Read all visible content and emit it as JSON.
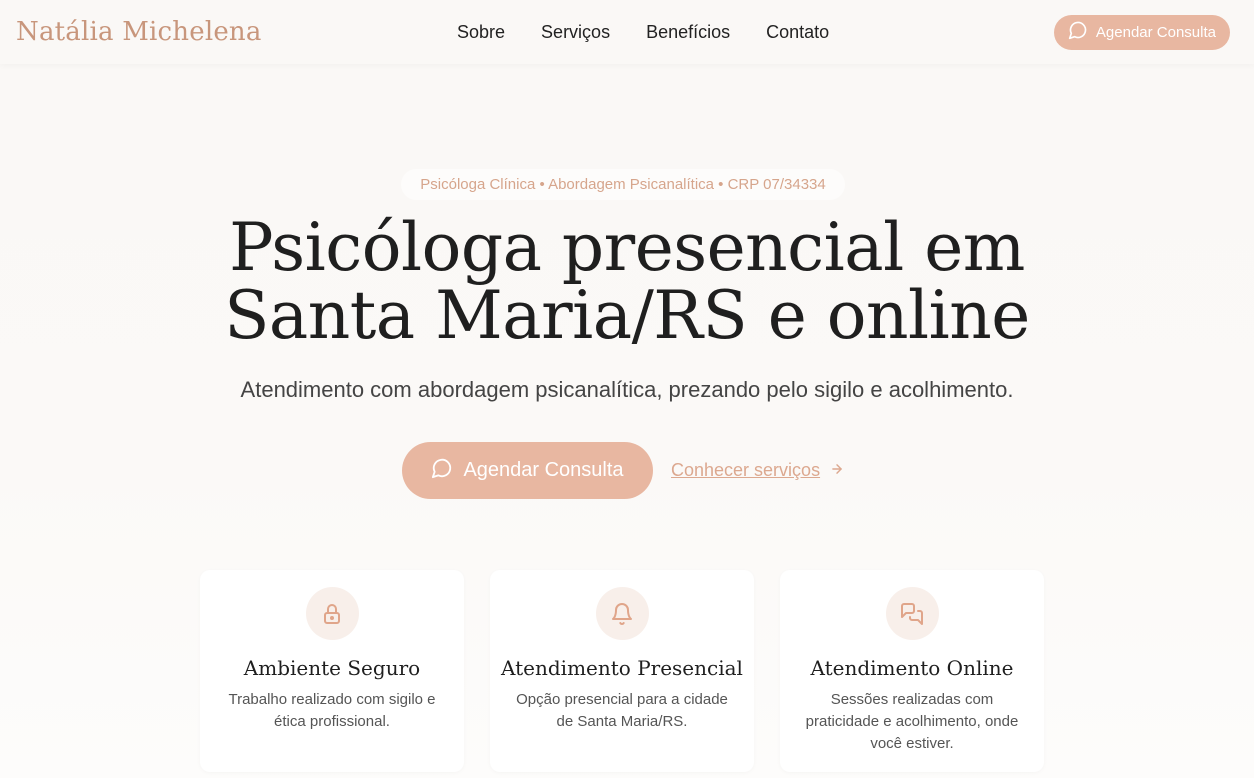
{
  "header": {
    "brand": "Natália Michelena",
    "nav": [
      "Sobre",
      "Serviços",
      "Benefícios",
      "Contato"
    ],
    "cta_label": "Agendar Consulta"
  },
  "hero": {
    "badge": "Psicóloga Clínica • Abordagem Psicanalítica • CRP 07/34334",
    "headline_line1": "Psicóloga presencial em",
    "headline_line2": "Santa Maria/RS e online",
    "subtitle": "Atendimento com abordagem psicanalítica, prezando pelo sigilo e acolhimento.",
    "primary_cta": "Agendar Consulta",
    "secondary_cta": "Conhecer serviços"
  },
  "cards": [
    {
      "icon": "lock-icon",
      "title": "Ambiente Seguro",
      "text": "Trabalho realizado com sigilo e ética profissional."
    },
    {
      "icon": "bell-icon",
      "title": "Atendimento Presencial",
      "text": "Opção presencial para a cidade de Santa Maria/RS."
    },
    {
      "icon": "chat-icon",
      "title": "Atendimento Online",
      "text": "Sessões realizadas com praticidade e acolhimento, onde você estiver."
    }
  ],
  "colors": {
    "accent": "#e8b7a1",
    "brand_text": "#c8967c",
    "icon": "#e0a58a"
  }
}
